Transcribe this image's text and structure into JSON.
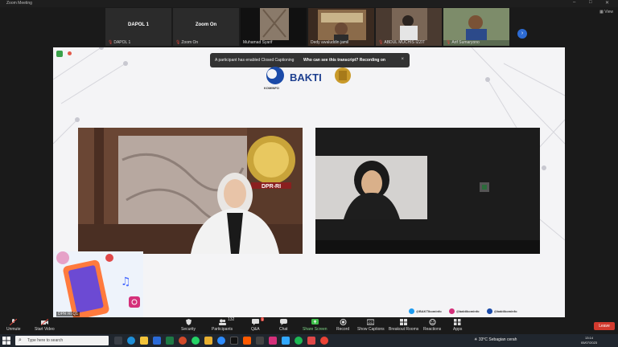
{
  "window": {
    "title": "Zoom Meeting",
    "view_label": "View"
  },
  "thumbnails": [
    {
      "name": "DAPOL 1",
      "big": "DAPOL 1"
    },
    {
      "name": "Zoom On",
      "big": "Zoom On"
    },
    {
      "name": "Muhamad Syarif"
    },
    {
      "name": "Dedy awaluddin jamil"
    },
    {
      "name": "ABDUL MUCHIS IZZIT"
    },
    {
      "name": "Arif Sumaryono"
    }
  ],
  "toast": {
    "message": "A participant has enabled Closed Captioning",
    "link": "Who can see this transcript? Recording on",
    "close": "×"
  },
  "stage": {
    "bakti": "BAKTI",
    "kominfo": "KOMINFO",
    "dpr": "DPR-RI",
    "bottom_name": "DPR RI Q1",
    "social": [
      "@BAKTIkominfo",
      "@baktikominfo",
      "@baktikominfo"
    ]
  },
  "toolbar": {
    "unmute": "Unmute",
    "start_video": "Start Video",
    "security": "Security",
    "participants": "Participants",
    "participants_count": "132",
    "qa": "Q&A",
    "qa_badge": "1",
    "chat": "Chat",
    "share_screen": "Share Screen",
    "record": "Record",
    "show_captions": "Show Captions",
    "breakout_rooms": "Breakout Rooms",
    "reactions": "Reactions",
    "apps": "Apps",
    "leave": "Leave"
  },
  "taskbar": {
    "search_placeholder": "Type here to search",
    "weather": "33°C  Sebagian cerah",
    "time": "13:14",
    "date": "05/07/2023"
  },
  "colors": {
    "accent": "#2d6bd3",
    "leave": "#d23a2e",
    "share": "#3fbf4a"
  }
}
